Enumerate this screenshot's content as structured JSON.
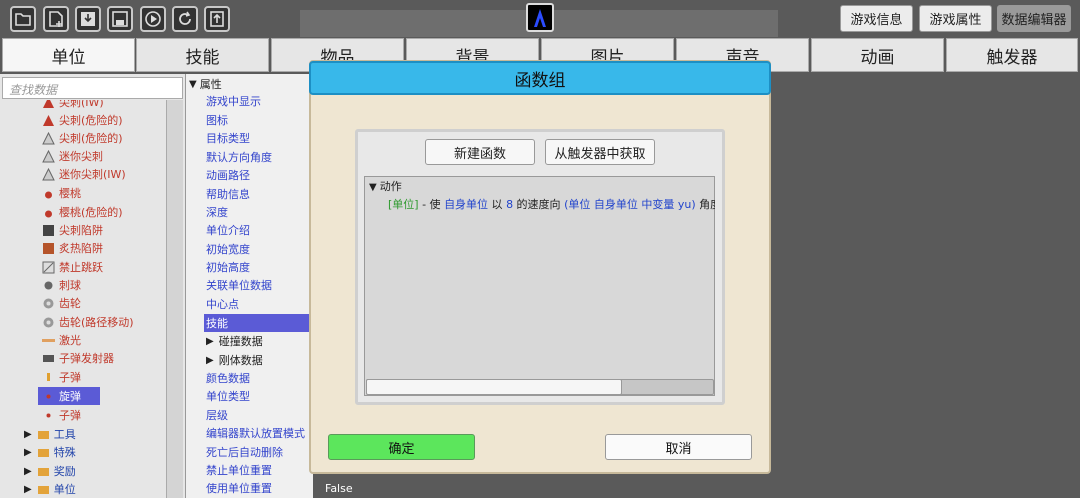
{
  "top_buttons": {
    "game_info": "游戏信息",
    "game_props": "游戏属性",
    "data_editor": "数据编辑器"
  },
  "tabs": [
    "单位",
    "技能",
    "物品",
    "背景",
    "图片",
    "声音",
    "动画",
    "触发器"
  ],
  "search": {
    "placeholder": "查找数据"
  },
  "tree": [
    {
      "label": "尖刺(IW)",
      "icon": "spike-icon",
      "color": "#c0392b"
    },
    {
      "label": "尖刺(危险的)",
      "icon": "spike-icon",
      "color": "#c0392b"
    },
    {
      "label": "尖刺(危险的)",
      "icon": "spike-icon",
      "color": "#c0392b"
    },
    {
      "label": "迷你尖刺",
      "icon": "spike-icon",
      "color": "#c0392b"
    },
    {
      "label": "迷你尖刺(IW)",
      "icon": "spike-icon",
      "color": "#c0392b"
    },
    {
      "label": "樱桃",
      "icon": "cherry-icon",
      "color": "#c0392b"
    },
    {
      "label": "樱桃(危险的)",
      "icon": "cherry-icon",
      "color": "#c0392b"
    },
    {
      "label": "尖刺陷阱",
      "icon": "trap-icon",
      "color": "#c0392b"
    },
    {
      "label": "炙热陷阱",
      "icon": "trap-icon",
      "color": "#c0392b"
    },
    {
      "label": "禁止跳跃",
      "icon": "nojump-icon",
      "color": "#c0392b"
    },
    {
      "label": "刺球",
      "icon": "spikeball-icon",
      "color": "#c0392b"
    },
    {
      "label": "齿轮",
      "icon": "gear-icon",
      "color": "#c0392b"
    },
    {
      "label": "齿轮(路径移动)",
      "icon": "gear-icon",
      "color": "#c0392b"
    },
    {
      "label": "激光",
      "icon": "laser-icon",
      "color": "#c0392b"
    },
    {
      "label": "子弹发射器",
      "icon": "launcher-icon",
      "color": "#c0392b"
    },
    {
      "label": "子弹",
      "icon": "bullet-icon",
      "color": "#c0392b"
    },
    {
      "label": "旋弹",
      "icon": "bullet-icon",
      "color": "#ffffff"
    },
    {
      "label": "子弹",
      "icon": "bullet-icon",
      "color": "#c0392b"
    }
  ],
  "folders": [
    "工具",
    "特殊",
    "奖励",
    "单位"
  ],
  "props_header": "属性",
  "props": [
    "游戏中显示",
    "图标",
    "目标类型",
    "默认方向角度",
    "动画路径",
    "帮助信息",
    "深度",
    "单位介绍",
    "初始宽度",
    "初始高度",
    "关联单位数据",
    "中心点",
    "技能",
    "碰撞数据",
    "刚体数据",
    "颜色数据",
    "单位类型",
    "层级",
    "编辑器默认放置模式",
    "死亡后自动删除",
    "禁止单位重置",
    "使用单位重置"
  ],
  "false_value": "False",
  "dialog": {
    "title": "函数组",
    "new_fn": "新建函数",
    "from_trigger": "从触发器中获取",
    "actions_header": "动作",
    "action": {
      "tag": "[单位]",
      "dash": " - 使 ",
      "self": "自身单位",
      "mid": " 以 ",
      "num": "8",
      "mid2": " 的速度向 ",
      "expr": "(单位 自身单位 中变量 yu)",
      "tail": " 角度"
    },
    "ok": "确定",
    "cancel": "取消"
  }
}
